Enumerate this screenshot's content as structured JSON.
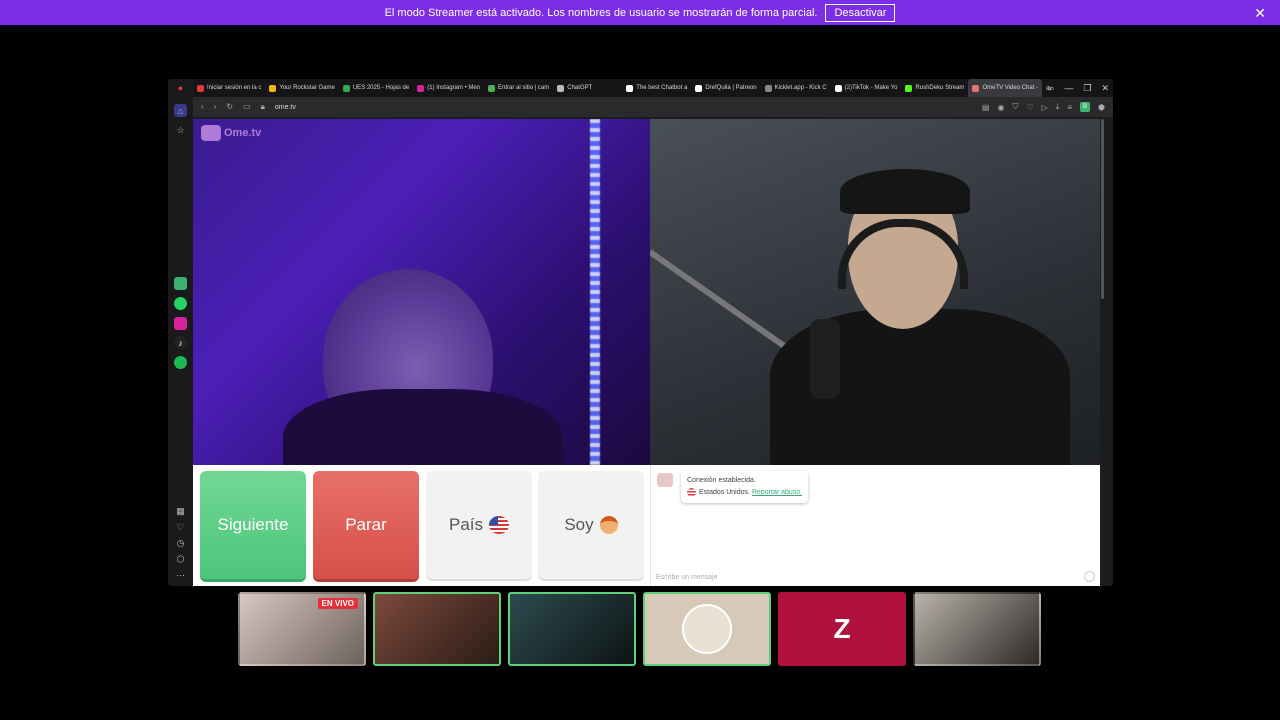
{
  "streamer_bar": {
    "message": "El modo Streamer está activado. Los nombres de usuario se mostrarán de forma parcial.",
    "button": "Desactivar",
    "close": "✕"
  },
  "browser": {
    "tabs": [
      {
        "label": "Iniciar sesión en la c",
        "color": "#e53935"
      },
      {
        "label": "Your Rockstar Game",
        "color": "#f7b500"
      },
      {
        "label": "UES 2025 - Hojas de",
        "color": "#34a853"
      },
      {
        "label": "(1) Instagram • Men",
        "color": "#d6249f"
      },
      {
        "label": "Entrar al sitio | cam",
        "color": "#4caf50"
      },
      {
        "label": "ChatGPT",
        "color": "#bbbbbb"
      },
      {
        "label": "The best Chatbot a",
        "color": "#ffffff"
      },
      {
        "label": "DrefQuila | Patreon",
        "color": "#ffffff"
      },
      {
        "label": "Kicklet.app - Kick C",
        "color": "#888888"
      },
      {
        "label": "(2)TikTok - Make Yo",
        "color": "#ffffff"
      },
      {
        "label": "RushDeku Stream",
        "color": "#53fc18"
      },
      {
        "label": "OmeTV Video Chat -",
        "color": "#e57373"
      }
    ],
    "url": "ome.tv",
    "profile_letter": "B"
  },
  "omegle": {
    "logo": "Ome.tv",
    "buttons": {
      "next": "Siguiente",
      "stop": "Parar",
      "country": "País",
      "sex": "Soy"
    },
    "chat": {
      "status": "Conexión establecida.",
      "country": "Estados Unidos.",
      "report": "Reportar abuso.",
      "placeholder": "Escribe un mensaje"
    }
  },
  "thumbnails": {
    "live_badge": "EN VIVO",
    "brand_letter": "Z"
  },
  "colors": {
    "streamer_bar": "#7b2ee6",
    "next_green": "#4cc57a",
    "stop_red": "#d55049"
  }
}
